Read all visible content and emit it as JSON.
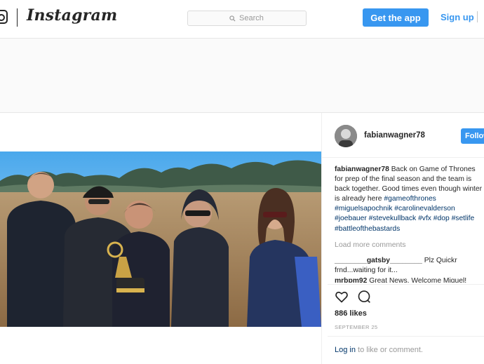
{
  "header": {
    "logo_text": "Instagram",
    "search_placeholder": "Search",
    "get_app_label": "Get the app",
    "signup_label": "Sign up"
  },
  "post": {
    "username": "fabianwagner78",
    "follow_label": "Follow",
    "caption": {
      "username": "fabianwagner78",
      "text": " Back on Game of Thrones for prep of the final season and the team is back together. Good times even though winter is already here ",
      "hashtags": "#gameofthrones #miguelsapochnik #carolinevalderson #joebauer #stevekullback #vfx #dop #setlife #battleofthebastards"
    },
    "load_more": "Load more comments",
    "comments": [
      {
        "username": "________gatsby________",
        "text": "Plz Quickr frnd...waiting for it..."
      },
      {
        "username": "mrbpm92",
        "text": "Great News. Welcome Miguel!"
      }
    ],
    "likes": "886 likes",
    "date": "SEPTEMBER 25",
    "login_link": "Log in",
    "login_suffix": " to like or comment."
  },
  "icons": [
    "instagram-glyph-icon",
    "search-icon",
    "heart-icon",
    "comment-icon"
  ],
  "colors": {
    "accent": "#3897f0",
    "link": "#003569",
    "muted": "#999999"
  }
}
